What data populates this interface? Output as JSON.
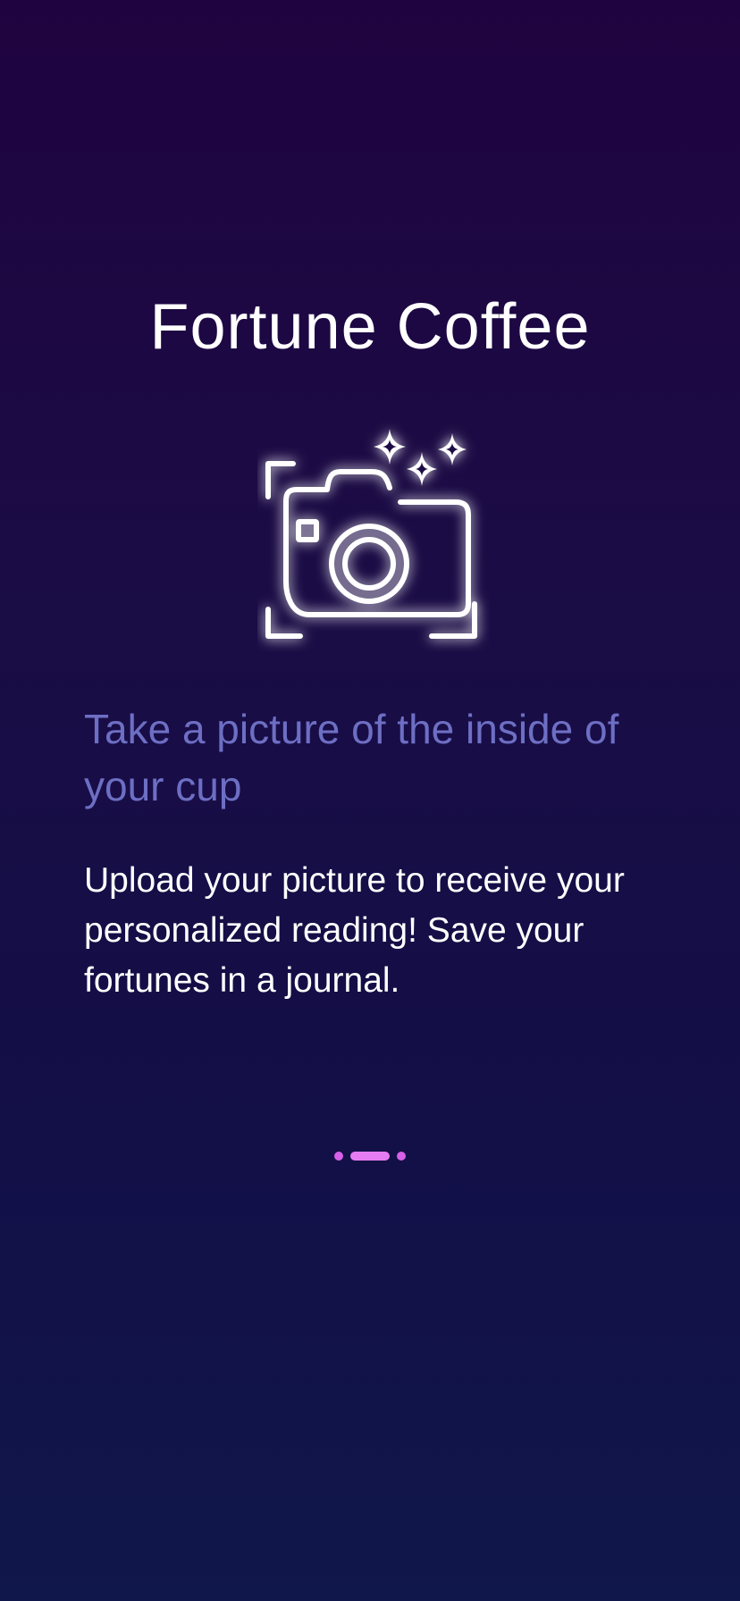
{
  "app": {
    "title": "Fortune Coffee"
  },
  "onboarding": {
    "icon": "camera-sparkles-icon",
    "headline": "Take a picture of the inside of your cup",
    "description": "Upload your picture to receive your personalized reading! Save your fortunes in a journal."
  },
  "pager": {
    "total_pages": 3,
    "current_page": 2
  },
  "colors": {
    "background_top": "#1f0340",
    "background_bottom": "#10174a",
    "headline": "#6d6fc4",
    "pager_active": "#e67cf1",
    "pager_inactive": "#d660e8"
  }
}
